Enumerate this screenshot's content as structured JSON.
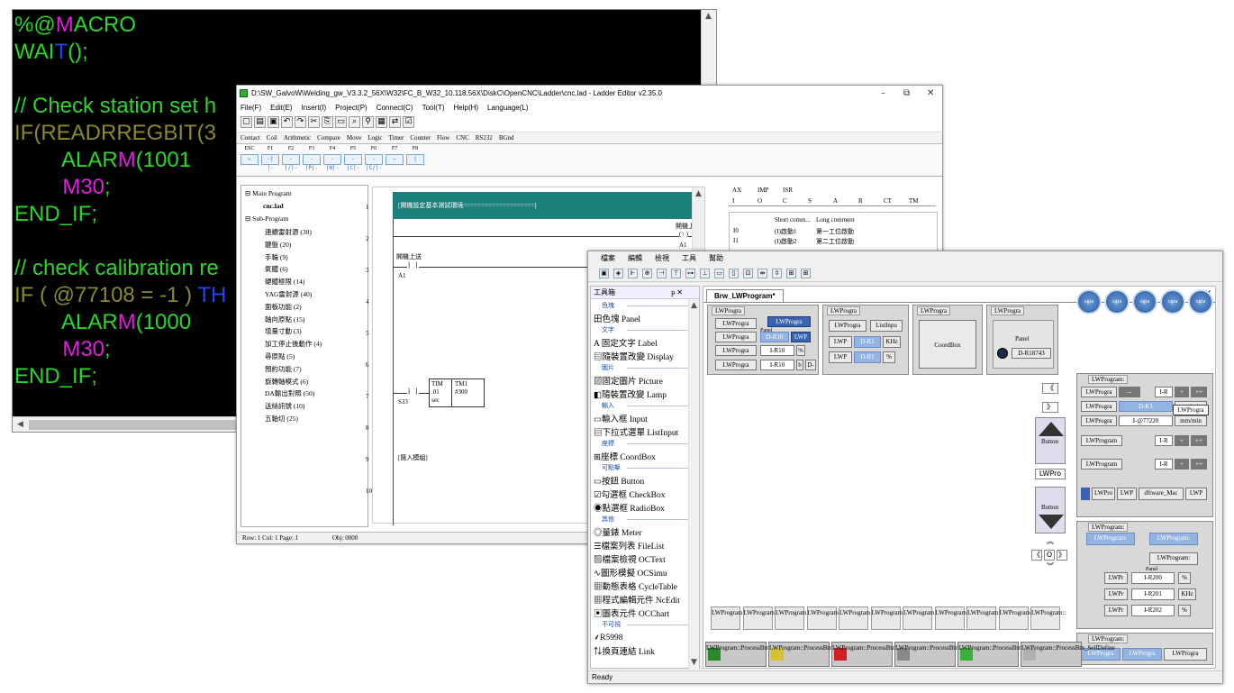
{
  "code_editor": {
    "lines": [
      [
        {
          "t": "%@",
          "c": "cg"
        },
        {
          "t": "M",
          "c": "cm"
        },
        {
          "t": "ACRO",
          "c": "cg"
        }
      ],
      [
        {
          "t": "WAI",
          "c": "cg"
        },
        {
          "t": "T",
          "c": "cb"
        },
        {
          "t": "();",
          "c": "cg"
        }
      ],
      [],
      [
        {
          "t": "// Check station set h",
          "c": "cg"
        }
      ],
      [
        {
          "t": "IF(READRREGBIT(3",
          "c": "cy"
        }
      ],
      [
        {
          "t": "        ALAR",
          "c": "cg"
        },
        {
          "t": "M",
          "c": "cm"
        },
        {
          "t": "(1001",
          "c": "cg"
        }
      ],
      [
        {
          "t": "        M30",
          "c": "cm"
        },
        {
          "t": ";",
          "c": "cg"
        }
      ],
      [
        {
          "t": "END_IF;",
          "c": "cg"
        }
      ],
      [],
      [
        {
          "t": "// check calibration re",
          "c": "cg"
        }
      ],
      [
        {
          "t": "IF ( @77108 = -1 ) ",
          "c": "cy"
        },
        {
          "t": "TH",
          "c": "cb"
        }
      ],
      [
        {
          "t": "        ALAR",
          "c": "cg"
        },
        {
          "t": "M",
          "c": "cm"
        },
        {
          "t": "(1000",
          "c": "cg"
        }
      ],
      [
        {
          "t": "        M30",
          "c": "cm"
        },
        {
          "t": ";",
          "c": "cg"
        }
      ],
      [
        {
          "t": "END_IF;",
          "c": "cg"
        }
      ]
    ]
  },
  "ladder": {
    "title": "D:\\SW_GalvoW\\Welding_gw_V3.3.2_56X\\W32\\FC_B_W32_10.118.56X\\DiskC\\OpenCNC\\Ladder\\cnc.lad - Ladder Editor v2.35.0",
    "menu": [
      "File(F)",
      "Edit(E)",
      "Insert(I)",
      "Project(P)",
      "Connect(C)",
      "Tool(T)",
      "Help(H)",
      "Language(L)"
    ],
    "toolbar_icons": [
      "new-icon",
      "open-icon",
      "save-icon",
      "undo-icon",
      "redo-icon",
      "cut-icon",
      "copy-icon",
      "paste-icon",
      "find-icon",
      "binoculars-icon",
      "compile-icon",
      "toggle-icon",
      "check-icon"
    ],
    "category_tabs": [
      "Contact",
      "Coil",
      "Arithmetic",
      "Compare",
      "Move",
      "Logic",
      "Timer",
      "Counter",
      "Flow",
      "CNC",
      "RS232",
      "BGnd"
    ],
    "palette": [
      {
        "key": "ESC",
        "sym": "↖"
      },
      {
        "key": "F1",
        "sym": "-| |-"
      },
      {
        "key": "F2",
        "sym": "-|/|-"
      },
      {
        "key": "F3",
        "sym": "-|P|-"
      },
      {
        "key": "F4",
        "sym": "-|N|-"
      },
      {
        "key": "F5",
        "sym": "-|C|-"
      },
      {
        "key": "F6",
        "sym": "-|C/|-"
      },
      {
        "key": "F7",
        "sym": "—"
      },
      {
        "key": "F8",
        "sym": "|"
      }
    ],
    "tree": {
      "main_program": "Main Program",
      "main_file": "cnc.lad",
      "sub_program": "Sub-Program",
      "items": [
        "連續雷射源 (30)",
        "鍵盤 (20)",
        "手輪 (9)",
        "氣體 (6)",
        "硬體極限 (14)",
        "YAG雷射源 (40)",
        "面板功能 (2)",
        "軸向原點 (15)",
        "增量寸動 (3)",
        "加工停止後動作 (4)",
        "尋原點 (5)",
        "預約功能 (7)",
        "旋轉軸模式 (6)",
        "DA輸出對照 (50)",
        "送絲訊號 (10)",
        "五軸切 (25)"
      ]
    },
    "rung_numbers": [
      "1",
      "2",
      "3",
      "4",
      "5",
      "6",
      "7",
      "8",
      "9",
      "10"
    ],
    "rung1_comment": "[開機設定基本測試環境====================]",
    "rung2_coil_label": "開機上送",
    "rung2_coil_symbol": "(↑ )",
    "rung2_coil_addr": "A1",
    "rung3_contact_label": "開機上送",
    "rung3_contact_addr": "A1",
    "rung7_contact_addr": "S33",
    "timer": {
      "name": "TIM",
      "value": ".01",
      "unit": "sec",
      "id": "TM1",
      "preset": "#300"
    },
    "rung9_comment": "[匯入模組]",
    "io_table": {
      "headers": [
        "AX",
        "IMP",
        "ISR"
      ],
      "cols": [
        "I",
        "O",
        "C",
        "S",
        "A",
        "R",
        "CT",
        "TM"
      ],
      "comment_headers": [
        "Short comm...",
        "Long comment"
      ],
      "rows": [
        {
          "addr": "I0",
          "short": "(I)啟動1",
          "long": "第一工位啟動"
        },
        {
          "addr": "I1",
          "short": "(I)啟動2",
          "long": "第二工位啟動"
        }
      ]
    },
    "status": {
      "pos": "Row: 1  Col: 1  Page: 1",
      "obj": "Obj: 0000"
    }
  },
  "designer": {
    "menu": [
      "檔案",
      "編輯",
      "檢視",
      "工具",
      "幫助"
    ],
    "toolbox_title": "工具箱",
    "toolbox_pin": "ᵽ ✕",
    "toolbox": [
      {
        "type": "cat",
        "text": "色塊"
      },
      {
        "type": "item",
        "text": "田色塊 Panel"
      },
      {
        "type": "cat",
        "text": "文字"
      },
      {
        "type": "item",
        "text": "A 固定文字 Label"
      },
      {
        "type": "item",
        "text": "▤隨裝置改變 Display"
      },
      {
        "type": "cat",
        "text": "圖片"
      },
      {
        "type": "item",
        "text": "▨固定圖片 Picture"
      },
      {
        "type": "item",
        "text": "◧隨裝置改變 Lamp"
      },
      {
        "type": "cat",
        "text": "輸入"
      },
      {
        "type": "item",
        "text": "▭輸入框 Input"
      },
      {
        "type": "item",
        "text": "▤下拉式選單 ListInput"
      },
      {
        "type": "cat",
        "text": "座標"
      },
      {
        "type": "item",
        "text": "⊞座標 CoordBox"
      },
      {
        "type": "cat",
        "text": "可點擊"
      },
      {
        "type": "item",
        "text": "▭按鈕 Button"
      },
      {
        "type": "item",
        "text": "☑勾選框 CheckBox"
      },
      {
        "type": "item",
        "text": "◉點選框 RadioBox"
      },
      {
        "type": "cat",
        "text": "其他"
      },
      {
        "type": "item",
        "text": "◎量錶 Meter"
      },
      {
        "type": "item",
        "text": "☰檔案列表 FileList"
      },
      {
        "type": "item",
        "text": "▧檔案檢視 OCText"
      },
      {
        "type": "item",
        "text": "∿圖形模擬 OCSimu"
      },
      {
        "type": "item",
        "text": "▦動態表格 CycleTable"
      },
      {
        "type": "item",
        "text": "▦程式編輯元件 NcEdit"
      },
      {
        "type": "item",
        "text": "▣圖表元件 OCChart"
      },
      {
        "type": "cat",
        "text": "不可視"
      },
      {
        "type": "item",
        "text": "⸙R5998"
      },
      {
        "type": "item",
        "text": "⇅換頁連結 Link"
      }
    ],
    "tab_label": "Brw_LWProgram*",
    "tab_close": "▾ ✕",
    "panels": {
      "p1_title": "LWProgra",
      "p1_cells": [
        "LWProgra",
        "LWProgra",
        "LWProgra",
        "LWProgra",
        "LWProgra",
        "D-R10",
        "LWP",
        "I-R10",
        "%",
        "I-R10",
        "b",
        "D-"
      ],
      "p1_small_label": "Panel",
      "p2_title": "LWProgra",
      "p2_cells": [
        "LWProgra",
        "ListInpu",
        "LWP",
        "D-R1",
        "KHz",
        "LWP",
        "D-R1",
        "%"
      ],
      "p3_title": "LWProgra",
      "p3_label": "CoordBox",
      "p4_title": "LWProgra",
      "p4_label": "Panel",
      "p4_value": "D-R18743"
    },
    "nav": {
      "left": "《",
      "right": "》",
      "up": "︽",
      "down": "︾",
      "lt": "《",
      "o": "O",
      "gt": "》",
      "button": "Button",
      "lwpro": "LWPro"
    },
    "right_group1": {
      "title": "LWProgram:",
      "rows": [
        [
          "LWProgra",
          "I-R",
          "+",
          "++"
        ],
        [
          "LWProgra",
          "D-K1",
          "mm/min"
        ],
        [
          "LWProgra",
          "I-@77220",
          "mm/min"
        ],
        [
          "LWProgram",
          "I-R",
          "+",
          "++"
        ],
        [
          "LWProgram",
          "I-R",
          "+",
          "++"
        ],
        [
          "LWPro",
          "LWP",
          "dftware_Mac",
          "LWP"
        ]
      ],
      "popup": "LWProgra"
    },
    "right_group2": {
      "title": "LWProgram:",
      "row1": [
        "LWProgram:",
        "LWProgram:"
      ],
      "row2": "LWProgram:",
      "panel_label": "Panel",
      "rows": [
        [
          "LWPr",
          "I-R200",
          "%"
        ],
        [
          "LWPr",
          "I-R201",
          "KHz"
        ],
        [
          "LWPr",
          "I-R202",
          "%"
        ]
      ]
    },
    "right_group3": {
      "title": "LWProgram:",
      "cells": [
        "LWProgra",
        "LWProgra",
        "LWProgra"
      ]
    },
    "circle_label": "ogra",
    "cell_buttons": [
      "LWProgram::",
      "LWProgram::",
      "LWProgram::",
      "LWProgram::",
      "LWProgram::",
      "LWProgram::",
      "LWProgram::",
      "LWProgram::",
      "LWProgram::",
      "LWProgram::",
      "LWProgram::"
    ],
    "process_buttons": [
      {
        "text": "LWProgram::ProcessBtn_Start",
        "color": "#2a8a2a"
      },
      {
        "text": "LWProgram::ProcessBtn_Pause",
        "color": "#d8c030"
      },
      {
        "text": "LWProgram::ProcessBtn_Reset",
        "color": "#d02020"
      },
      {
        "text": "LWProgram::ProcessBtn_MPGSimu",
        "color": "#888"
      },
      {
        "text": "LWProgram::ProcessBtn_ContinueWeld",
        "color": "#3ab03a"
      },
      {
        "text": "LWProgram::ProcessBtn_SelfDefine",
        "color": "#b0b0b0"
      }
    ],
    "status": "Ready"
  }
}
